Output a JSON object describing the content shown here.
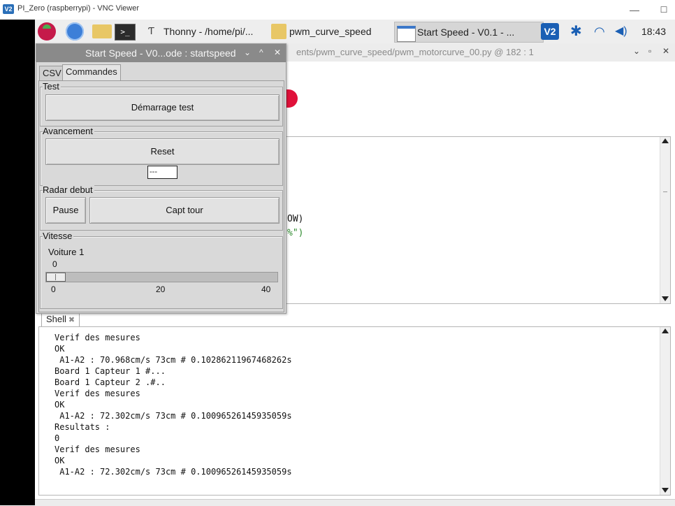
{
  "vnc": {
    "title": "PI_Zero (raspberrypi) - VNC Viewer",
    "logo": "V2",
    "min": "—",
    "max": "☐"
  },
  "taskbar": {
    "thonny_label": "Thonny  -  /home/pi/...",
    "curve_label": "pwm_curve_speed",
    "startspeed_label": "Start Speed - V0.1 - ...",
    "term_glyph": ">_",
    "vnc_tray": "V2",
    "bt_glyph": "✱",
    "wifi_glyph": "◠",
    "vol_glyph": "◀)",
    "clock": "18:43"
  },
  "thonny": {
    "path": "ents/pwm_curve_speed/pwm_motorcurve_00.py  @  182 : 1",
    "ctl_down": "⌄",
    "ctl_max": "▫",
    "ctl_close": "✕",
    "code_lines": [
      "OW)",
      "%\")"
    ]
  },
  "shell": {
    "tab_label": "Shell",
    "close": "✖",
    "lines": [
      "Verif des mesures",
      "OK",
      " A1-A2 : 70.968cm/s 73cm # 0.10286211967468262s",
      "Board 1 Capteur 1 #...",
      "Board 1 Capteur 2 .#..",
      "Verif des mesures",
      "OK",
      " A1-A2 : 72.302cm/s 73cm # 0.10096526145935059s",
      "Resultats :",
      "0",
      "Verif des mesures",
      "OK",
      " A1-A2 : 72.302cm/s 73cm # 0.10096526145935059s"
    ]
  },
  "startspeed": {
    "title": "Start Speed - V0...ode : startspeed",
    "ctl_down": "⌄",
    "ctl_up": "^",
    "ctl_close": "✕",
    "tabs": [
      "CSV",
      "Commandes"
    ],
    "test": {
      "label": "Test",
      "button": "Démarrage test"
    },
    "avancement": {
      "label": "Avancement",
      "button": "Reset",
      "counter": "---"
    },
    "radar": {
      "label": "Radar debut",
      "pause": "Pause",
      "capt": "Capt tour"
    },
    "vitesse": {
      "label": "Vitesse",
      "car": "Voiture 1",
      "value": "0",
      "value_num": 0,
      "min": 0,
      "max": 40,
      "ticks": [
        "0",
        "20",
        "40"
      ]
    }
  }
}
